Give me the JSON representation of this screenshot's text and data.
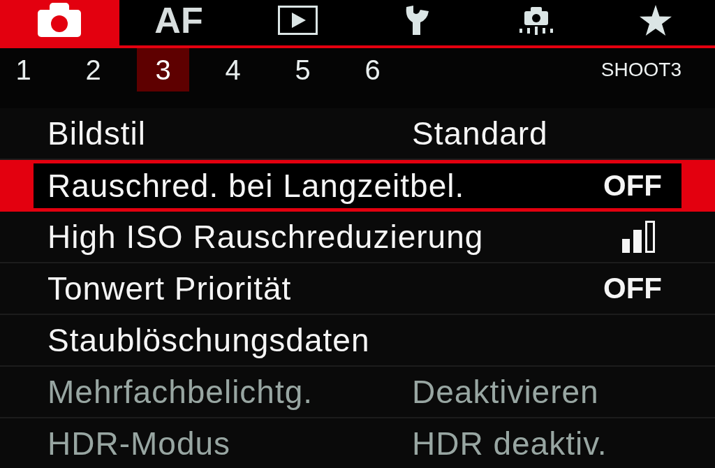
{
  "main_tabs": [
    {
      "kind": "camera",
      "selected": true
    },
    {
      "kind": "text",
      "label": "AF",
      "selected": false
    },
    {
      "kind": "playback",
      "selected": false
    },
    {
      "kind": "wrench",
      "selected": false
    },
    {
      "kind": "cleaning",
      "selected": false
    },
    {
      "kind": "star",
      "selected": false
    }
  ],
  "page_tabs": [
    {
      "label": "1",
      "selected": false
    },
    {
      "label": "2",
      "selected": false
    },
    {
      "label": "3",
      "selected": true
    },
    {
      "label": "4",
      "selected": false
    },
    {
      "label": "5",
      "selected": false
    },
    {
      "label": "6",
      "selected": false
    }
  ],
  "page_label": "SHOOT3",
  "menu_items": [
    {
      "kind": "option",
      "label": "Bildstil",
      "value": "Standard",
      "selected": false,
      "disabled": false
    },
    {
      "kind": "switch",
      "label": "Rauschred. bei Langzeitbel.",
      "value": "OFF",
      "selected": true,
      "disabled": false
    },
    {
      "kind": "level",
      "label": "High ISO Rauschreduzierung",
      "level": 0.67,
      "selected": false,
      "disabled": false
    },
    {
      "kind": "switch",
      "label": "Tonwert Priorität",
      "value": "OFF",
      "selected": false,
      "disabled": false
    },
    {
      "kind": "plain",
      "label": "Staublöschungsdaten",
      "selected": false,
      "disabled": false
    },
    {
      "kind": "option",
      "label": "Mehrfachbelichtg.",
      "value": "Deaktivieren",
      "selected": false,
      "disabled": true
    },
    {
      "kind": "option",
      "label": "HDR-Modus",
      "value": "HDR deaktiv.",
      "selected": false,
      "disabled": true
    }
  ]
}
